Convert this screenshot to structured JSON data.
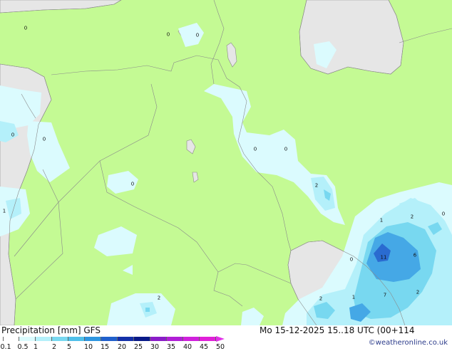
{
  "map": {
    "land_color": "#c4fa94",
    "sea_color": "#e6e6e6",
    "precip_colors": [
      "#dbfbfe",
      "#b4f0fa",
      "#78d8f0",
      "#45a8e6",
      "#2a6bd0"
    ],
    "amount_labels": [
      "0",
      "0",
      "0",
      "0",
      "0",
      "0",
      "2",
      "0",
      "1",
      "1",
      "2",
      "0",
      "6",
      "11",
      "0",
      "2",
      "1",
      "7",
      "2",
      "2",
      "0"
    ]
  },
  "footer": {
    "product_label": "Precipitation [mm] GFS",
    "datetime_label": "Mo 15-12-2025 15..18 UTC (00+114",
    "credit": "©weatheronline.co.uk",
    "scale_ticks": [
      "0.1",
      "0.5",
      "1",
      "2",
      "5",
      "10",
      "15",
      "20",
      "25",
      "30",
      "35",
      "40",
      "45",
      "50"
    ],
    "scale_colors": [
      "#ffffff",
      "#dbfbfe",
      "#b4f0fa",
      "#78d8f0",
      "#50c0ea",
      "#2e96e0",
      "#2060cc",
      "#1430a8",
      "#0a1a88",
      "#8a1cc8",
      "#b01ed6",
      "#d020dc",
      "#e020d8"
    ]
  }
}
